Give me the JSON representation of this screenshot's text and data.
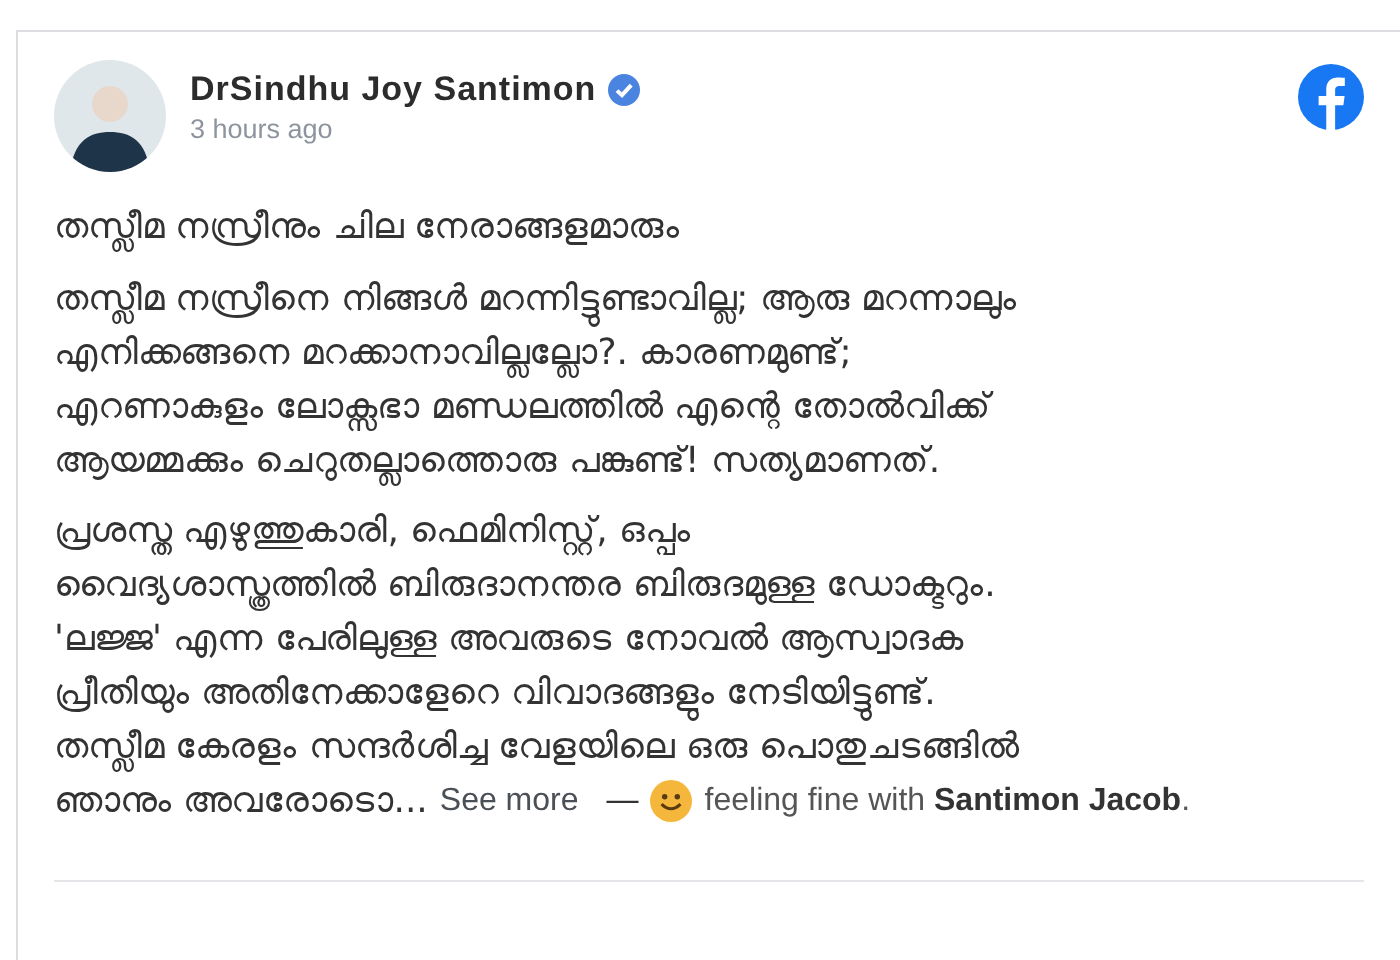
{
  "post": {
    "author": "DrSindhu Joy Santimon",
    "verified": true,
    "time": "3 hours ago",
    "title": "തസ്ലീമ നസ്രീനും ചില നേരാങ്ങളമാരും",
    "paragraphs": [
      [
        "തസ്ലീമ നസ്രീനെ നിങ്ങൾ മറന്നിട്ടുണ്ടാവില്ല; ആരു മറന്നാലും",
        "എനിക്കങ്ങനെ മറക്കാനാവില്ലല്ലോ?. കാരണമുണ്ട്;",
        "എറണാകുളം ലോക്സഭാ മണ്ഡലത്തിൽ എന്റെ തോൽവിക്ക്",
        "ആയമ്മക്കും ചെറുതല്ലാത്തൊരു പങ്കുണ്ട്! സത്യമാണത്."
      ],
      [
        "പ്രശസ്ത എഴുത്തുകാരി, ഫെമിനിസ്റ്റ്, ഒപ്പം",
        "വൈദ്യശാസ്ത്രത്തിൽ ബിരുദാനന്തര ബിരുദമുള്ള ഡോക്ടറും.",
        "'ലജ്ജ' എന്ന പേരിലുള്ള അവരുടെ നോവൽ ആസ്വാദക",
        "പ്രീതിയും അതിനേക്കാളേറെ വിവാദങ്ങളും നേടിയിട്ടുണ്ട്.",
        "തസ്ലീമ കേരളം സന്ദർശിച്ച വേളയിലെ ഒരു പൊതുചടങ്ങിൽ"
      ]
    ],
    "last_line": "ഞാനും അവരോടൊ...",
    "see_more": "See more",
    "dash": "—",
    "feeling": "feeling fine with **Santimon Jacob**."
  }
}
